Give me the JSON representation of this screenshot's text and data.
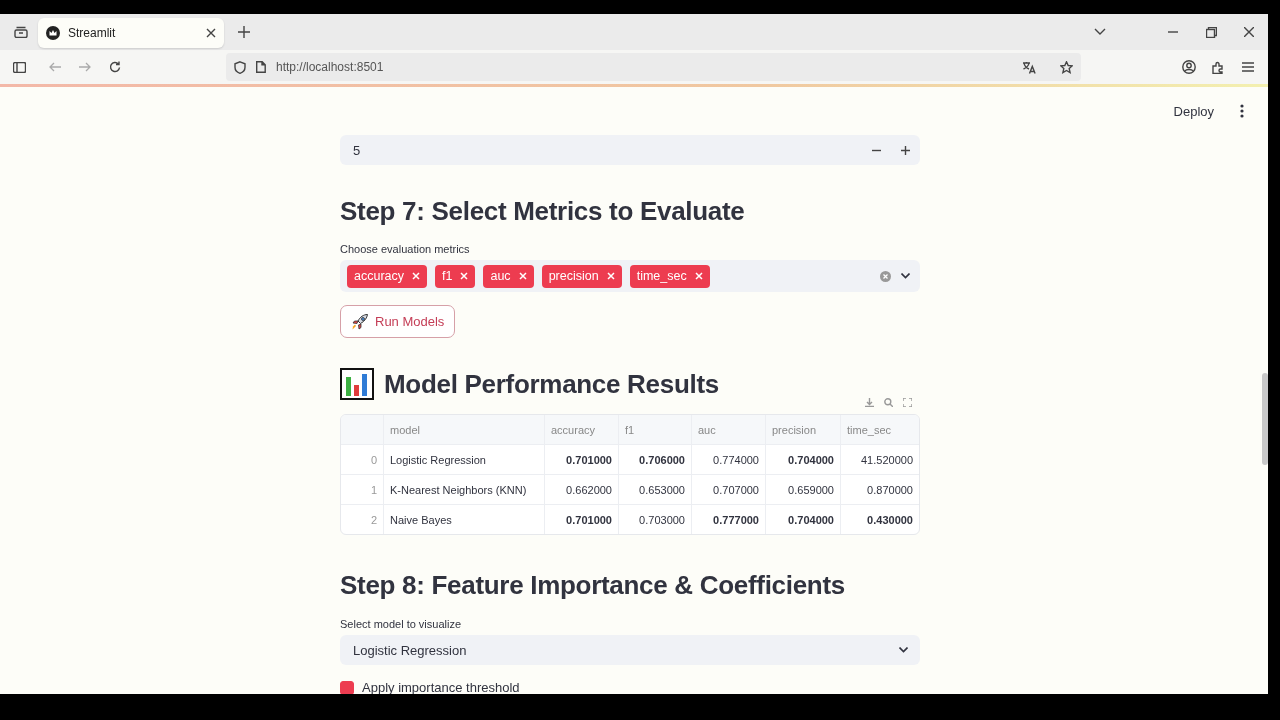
{
  "browser": {
    "tab_title": "Streamlit",
    "url": "http://localhost:8501"
  },
  "header": {
    "deploy": "Deploy"
  },
  "number_input": {
    "value": "5"
  },
  "step7": {
    "heading": "Step 7: Select Metrics to Evaluate",
    "label": "Choose evaluation metrics",
    "metrics": [
      "accuracy",
      "f1",
      "auc",
      "precision",
      "time_sec"
    ],
    "button": "Run Models"
  },
  "results": {
    "heading": "Model Performance Results",
    "columns": [
      "model",
      "accuracy",
      "f1",
      "auc",
      "precision",
      "time_sec"
    ],
    "rows": [
      {
        "index": "0",
        "cells": [
          {
            "text": "Logistic Regression",
            "best": false
          },
          {
            "text": "0.701000",
            "best": true
          },
          {
            "text": "0.706000",
            "best": true
          },
          {
            "text": "0.774000",
            "best": false
          },
          {
            "text": "0.704000",
            "best": true
          },
          {
            "text": "41.520000",
            "best": false
          }
        ]
      },
      {
        "index": "1",
        "cells": [
          {
            "text": "K-Nearest Neighbors (KNN)",
            "best": false
          },
          {
            "text": "0.662000",
            "best": false
          },
          {
            "text": "0.653000",
            "best": false
          },
          {
            "text": "0.707000",
            "best": false
          },
          {
            "text": "0.659000",
            "best": false
          },
          {
            "text": "0.870000",
            "best": false
          }
        ]
      },
      {
        "index": "2",
        "cells": [
          {
            "text": "Naive Bayes",
            "best": false
          },
          {
            "text": "0.701000",
            "best": true
          },
          {
            "text": "0.703000",
            "best": false
          },
          {
            "text": "0.777000",
            "best": true
          },
          {
            "text": "0.704000",
            "best": true
          },
          {
            "text": "0.430000",
            "best": true
          }
        ]
      }
    ]
  },
  "step8": {
    "heading": "Step 8: Feature Importance & Coefficients",
    "label": "Select model to visualize",
    "select": "Logistic Regression",
    "checkbox": {
      "label": "Apply importance threshold",
      "checked": true
    }
  }
}
